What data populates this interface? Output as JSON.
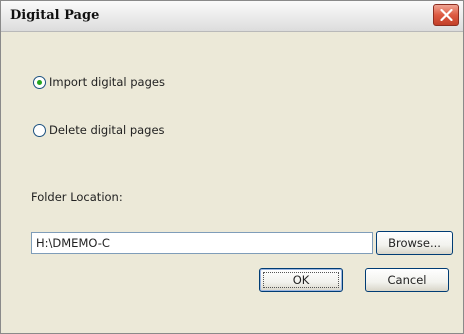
{
  "window": {
    "title": "Digital Page",
    "close_icon": "close-icon",
    "close_color": "#d9553d"
  },
  "options": {
    "import_label": "Import digital pages",
    "delete_label": "Delete digital pages",
    "selected": "import"
  },
  "folder": {
    "label": "Folder Location:",
    "value": "H:\\DMEMO-C",
    "browse_label": "Browse..."
  },
  "buttons": {
    "ok_label": "OK",
    "cancel_label": "Cancel"
  }
}
